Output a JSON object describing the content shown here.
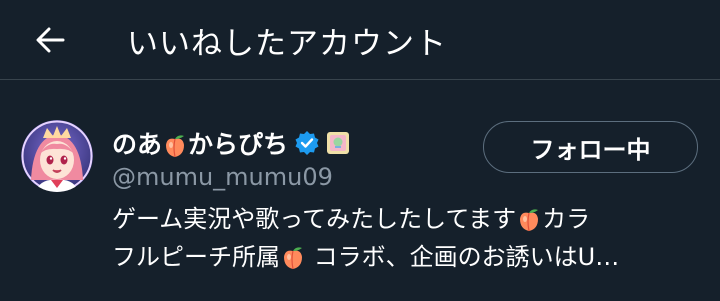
{
  "header": {
    "title": "いいねしたアカウント",
    "back_icon": "arrow-left-icon"
  },
  "account": {
    "name_part1": "のあ",
    "name_part2": "からぴち",
    "verified_icon": "verified-badge-icon",
    "affiliate_badge_icon": "affiliate-badge-icon",
    "handle": "@mumu_mumu09",
    "follow_button_label": "フォロー中",
    "bio_line1_a": "ゲーム実況や歌ってみたしたしてます",
    "bio_line1_b": "カラ",
    "bio_line2_a": "フルピーチ所属",
    "bio_line2_b": " コラボ、企画のお誘いはU…",
    "emoji_icon": "peach-emoji-icon"
  },
  "colors": {
    "background": "#15202b",
    "divider": "#38444d",
    "secondary_text": "#8b98a5",
    "verified_blue": "#1d9bf0",
    "button_border": "#5c6e7e"
  }
}
